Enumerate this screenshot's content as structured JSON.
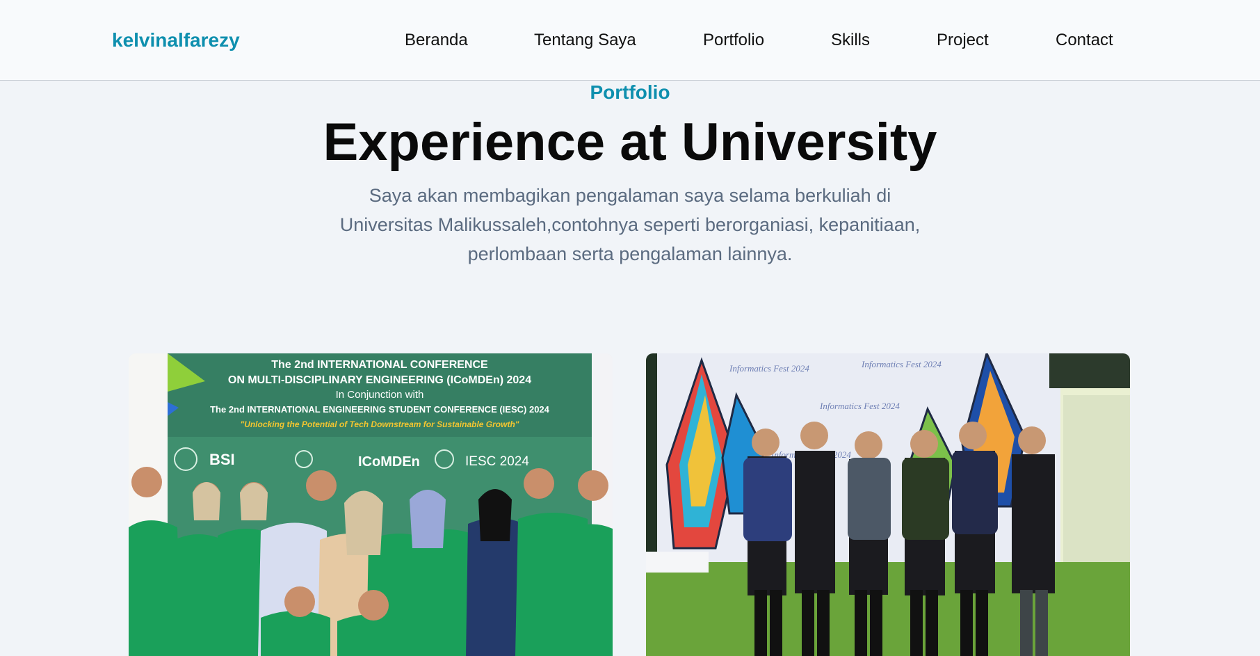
{
  "nav": {
    "brand": "kelvinalfarezy",
    "links": [
      "Beranda",
      "Tentang Saya",
      "Portfolio",
      "Skills",
      "Project",
      "Contact"
    ]
  },
  "hero": {
    "eyebrow": "Portfolio",
    "title": "Experience at University",
    "description": "Saya akan membagikan pengalaman saya selama berkuliah di Universitas Malikussaleh,contohnya seperti berorganiasi, kepanitiaan, perlombaan serta pengalaman lainnya."
  },
  "cards": [
    {
      "banner_line_1": "The 2nd INTERNATIONAL CONFERENCE",
      "banner_line_2": "ON MULTI-DISCIPLINARY ENGINEERING (ICoMDEn) 2024",
      "banner_line_3": "In Conjunction with",
      "banner_line_4": "The 2nd INTERNATIONAL ENGINEERING STUDENT CONFERENCE (IESC) 2024",
      "banner_tagline": "\"Unlocking the Potential of Tech Downstream for Sustainable Growth\"",
      "sponsor_1": "BSI",
      "sponsor_2": "ICoMDEn",
      "sponsor_3": "IESC 2024"
    },
    {
      "backdrop_text": "Informatics Fest 2024"
    }
  ],
  "colors": {
    "accent": "#0e8fae",
    "page_bg": "#f1f4f8",
    "nav_bg": "#f8fafc",
    "banner_green": "#3f8f6e",
    "jacket_green": "#1aa05a"
  }
}
